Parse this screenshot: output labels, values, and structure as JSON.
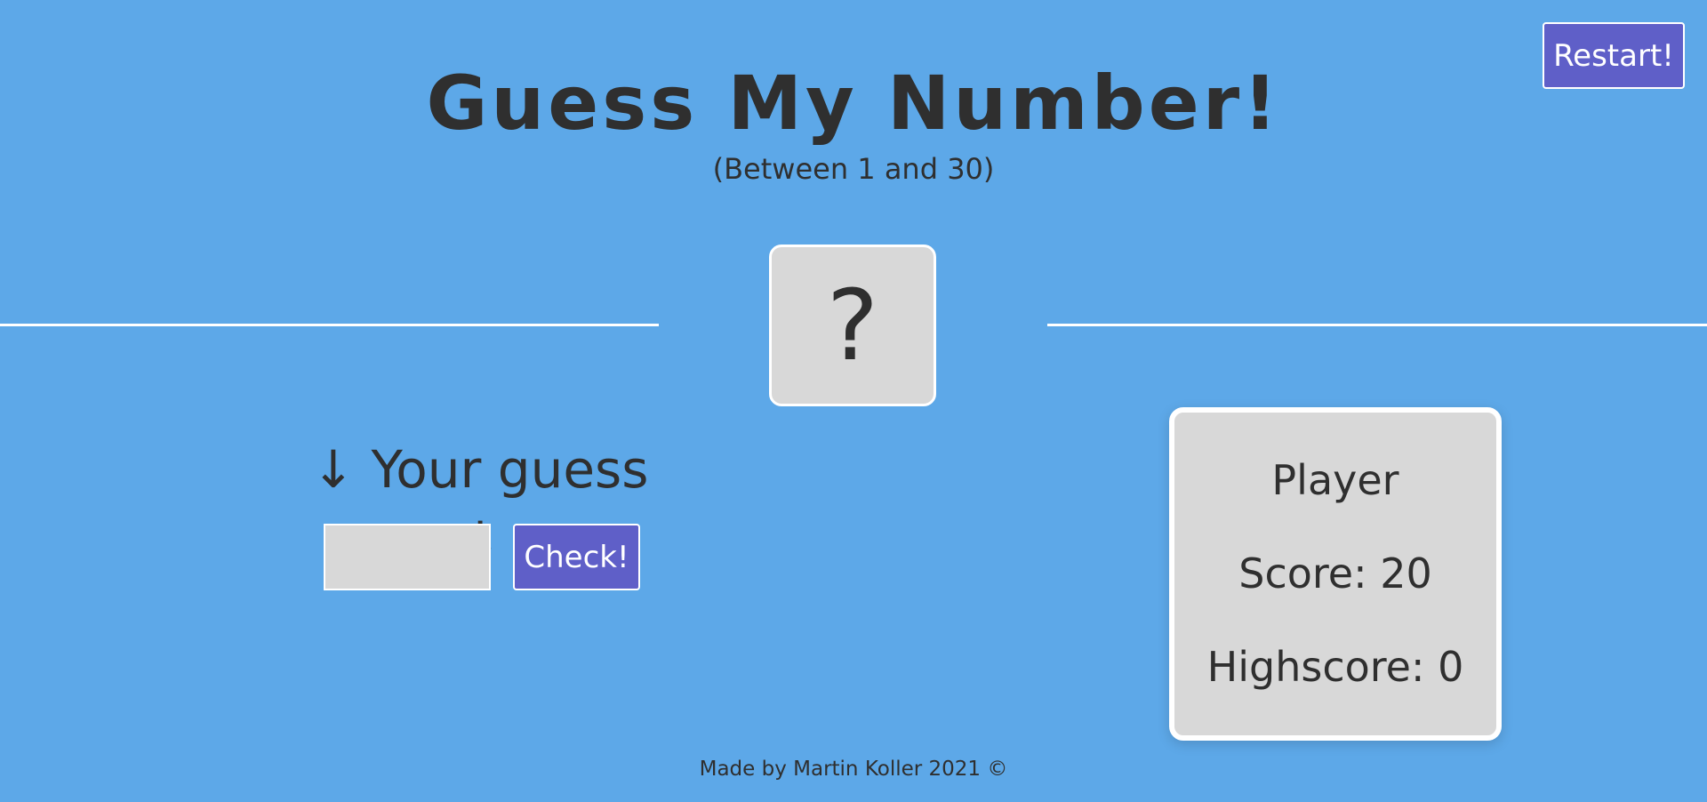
{
  "header": {
    "restart_label": "Restart!",
    "title": "Guess My Number!",
    "subtitle": "(Between 1 and 30)"
  },
  "secret": {
    "display": "?"
  },
  "guess": {
    "label": "↓ Your guess ↓",
    "input_value": "",
    "check_label": "Check!"
  },
  "scoreboard": {
    "player_label": "Player",
    "score_text": "Score: 20",
    "highscore_text": "Highscore: 0"
  },
  "footer": {
    "text": "Made by Martin Koller 2021 ©"
  },
  "colors": {
    "background": "#5da8e8",
    "button": "#5f5fc8",
    "card": "#d8d8d8",
    "text": "#2f2f2f"
  }
}
